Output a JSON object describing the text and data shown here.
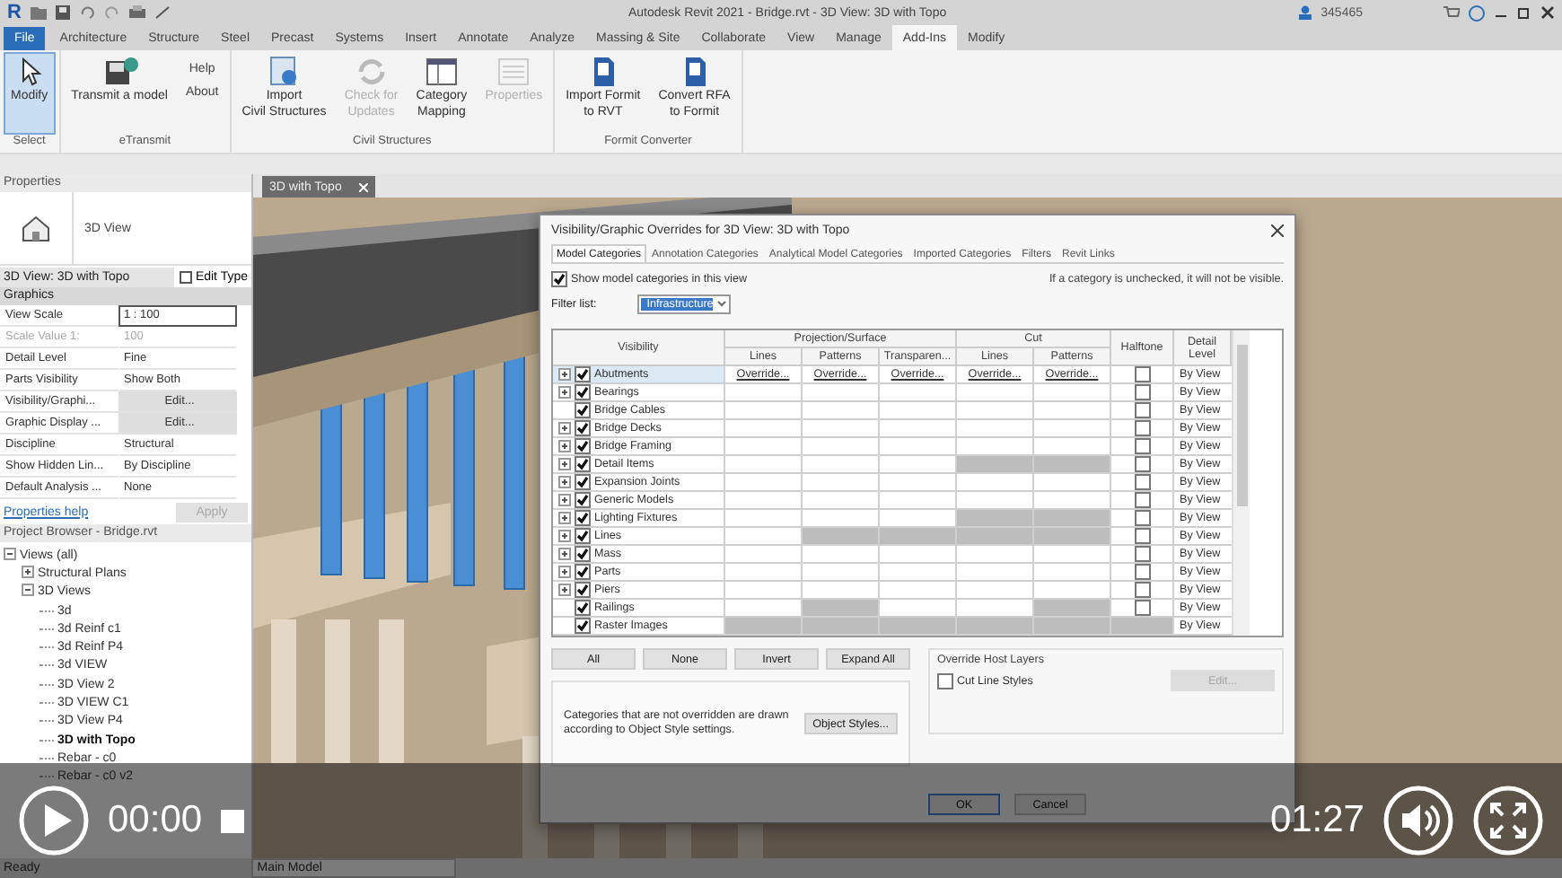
{
  "title_bar": {
    "logo": "R",
    "title": "Autodesk Revit 2021 - Bridge.rvt - 3D View: 3D with Topo",
    "user": "345465"
  },
  "ribbon_tabs": {
    "file": "File",
    "tabs": [
      {
        "label": "Architecture",
        "selected": false
      },
      {
        "label": "Structure",
        "selected": false
      },
      {
        "label": "Steel",
        "selected": false
      },
      {
        "label": "Precast",
        "selected": false
      },
      {
        "label": "Systems",
        "selected": false
      },
      {
        "label": "Insert",
        "selected": false
      },
      {
        "label": "Annotate",
        "selected": false
      },
      {
        "label": "Analyze",
        "selected": false
      },
      {
        "label": "Massing & Site",
        "selected": false
      },
      {
        "label": "Collaborate",
        "selected": false
      },
      {
        "label": "View",
        "selected": false
      },
      {
        "label": "Manage",
        "selected": false
      },
      {
        "label": "Add-Ins",
        "selected": true
      },
      {
        "label": "Modify",
        "selected": false
      }
    ]
  },
  "ribbon": {
    "panels": [
      {
        "label": "Select",
        "tools": [
          {
            "lines": [
              "Modify"
            ],
            "active": true,
            "disabled": false
          }
        ]
      },
      {
        "label": "eTransmit",
        "tools": [
          {
            "lines": [
              "Transmit a model"
            ],
            "active": false,
            "disabled": false
          }
        ],
        "links": [
          "Help",
          "About"
        ]
      },
      {
        "label": "Civil Structures",
        "tools": [
          {
            "lines": [
              "Import",
              "Civil Structures"
            ],
            "active": false,
            "disabled": false
          },
          {
            "lines": [
              "Check for",
              "Updates"
            ],
            "active": false,
            "disabled": true
          },
          {
            "lines": [
              "Category",
              "Mapping"
            ],
            "active": false,
            "disabled": false
          },
          {
            "lines": [
              "Properties"
            ],
            "active": false,
            "disabled": true
          }
        ]
      },
      {
        "label": "Formit Converter",
        "tools": [
          {
            "lines": [
              "Import Formit",
              "to RVT"
            ],
            "active": false,
            "disabled": false
          },
          {
            "lines": [
              "Convert RFA",
              "to Formit"
            ],
            "active": false,
            "disabled": false
          }
        ]
      }
    ]
  },
  "properties": {
    "title": "Properties",
    "type_name": "3D View",
    "instance": "3D View: 3D with Topo",
    "edit_type": "Edit Type",
    "section": "Graphics",
    "rows": [
      {
        "label": "View Scale",
        "value": "1 : 100",
        "kind": "input"
      },
      {
        "label": "Scale Value    1:",
        "value": "100",
        "kind": "readonly"
      },
      {
        "label": "Detail Level",
        "value": "Fine",
        "kind": "text"
      },
      {
        "label": "Parts Visibility",
        "value": "Show Both",
        "kind": "text"
      },
      {
        "label": "Visibility/Graphi...",
        "value": "Edit...",
        "kind": "button"
      },
      {
        "label": "Graphic Display ...",
        "value": "Edit...",
        "kind": "button"
      },
      {
        "label": "Discipline",
        "value": "Structural",
        "kind": "text"
      },
      {
        "label": "Show Hidden Lin...",
        "value": "By Discipline",
        "kind": "text"
      },
      {
        "label": "Default Analysis ...",
        "value": "None",
        "kind": "text"
      }
    ],
    "help": "Properties help",
    "apply": {
      "label": "Apply",
      "disabled": true
    }
  },
  "project_browser": {
    "title": "Project Browser - Bridge.rvt",
    "tree": [
      {
        "label": "Views (all)",
        "selected": false,
        "expanded": true,
        "children": [
          {
            "label": "Structural Plans",
            "selected": false,
            "expanded": false
          },
          {
            "label": "3D Views",
            "selected": false,
            "expanded": true,
            "children": [
              {
                "label": "3d",
                "selected": false
              },
              {
                "label": "3d Reinf c1",
                "selected": false
              },
              {
                "label": "3d Reinf P4",
                "selected": false
              },
              {
                "label": "3d VIEW",
                "selected": false
              },
              {
                "label": "3D View 2",
                "selected": false
              },
              {
                "label": "3D VIEW C1",
                "selected": false
              },
              {
                "label": "3D View P4",
                "selected": false
              },
              {
                "label": "3D with Topo",
                "selected": true
              },
              {
                "label": "Rebar -  c0",
                "selected": false
              },
              {
                "label": "Rebar -  c0 v2",
                "selected": false
              }
            ]
          }
        ]
      }
    ]
  },
  "view_tab": {
    "label": "3D with Topo"
  },
  "dialog": {
    "title": "Visibility/Graphic Overrides for 3D View: 3D with Topo",
    "tabs": [
      {
        "label": "Model Categories",
        "selected": true
      },
      {
        "label": "Annotation Categories",
        "selected": false
      },
      {
        "label": "Analytical Model Categories",
        "selected": false
      },
      {
        "label": "Imported Categories",
        "selected": false
      },
      {
        "label": "Filters",
        "selected": false
      },
      {
        "label": "Revit Links",
        "selected": false
      }
    ],
    "show_categories": {
      "label": "Show model categories in this view",
      "checked": true
    },
    "note": "If a category is unchecked, it will not be visible.",
    "filter": {
      "label": "Filter list:",
      "value": "Infrastructure"
    },
    "columns": {
      "visibility": "Visibility",
      "projection": "Projection/Surface",
      "projection_sub": [
        "Lines",
        "Patterns",
        "Transparen..."
      ],
      "cut": "Cut",
      "cut_sub": [
        "Lines",
        "Patterns"
      ],
      "halftone": "Halftone",
      "detail": "Detail Level"
    },
    "categories": [
      {
        "name": "Abutments",
        "expandable": true,
        "checked": true,
        "selected": true,
        "cells": [
          {
            "text": "Override...",
            "disabled": false
          },
          {
            "text": "Override...",
            "disabled": false
          },
          {
            "text": "Override...",
            "disabled": false
          },
          {
            "text": "Override...",
            "disabled": false
          },
          {
            "text": "Override...",
            "disabled": false
          }
        ],
        "halftone": {
          "checked": false,
          "disabled": false
        },
        "detail": "By View"
      },
      {
        "name": "Bearings",
        "expandable": true,
        "checked": true,
        "selected": false,
        "cells": [
          {
            "disabled": false
          },
          {
            "disabled": false
          },
          {
            "disabled": false
          },
          {
            "disabled": false
          },
          {
            "disabled": false
          }
        ],
        "halftone": {
          "checked": false,
          "disabled": false
        },
        "detail": "By View"
      },
      {
        "name": "Bridge Cables",
        "expandable": false,
        "checked": true,
        "selected": false,
        "cells": [
          {
            "disabled": false
          },
          {
            "disabled": false
          },
          {
            "disabled": false
          },
          {
            "disabled": false
          },
          {
            "disabled": false
          }
        ],
        "halftone": {
          "checked": false,
          "disabled": false
        },
        "detail": "By View"
      },
      {
        "name": "Bridge Decks",
        "expandable": true,
        "checked": true,
        "selected": false,
        "cells": [
          {
            "disabled": false
          },
          {
            "disabled": false
          },
          {
            "disabled": false
          },
          {
            "disabled": false
          },
          {
            "disabled": false
          }
        ],
        "halftone": {
          "checked": false,
          "disabled": false
        },
        "detail": "By View"
      },
      {
        "name": "Bridge Framing",
        "expandable": true,
        "checked": true,
        "selected": false,
        "cells": [
          {
            "disabled": false
          },
          {
            "disabled": false
          },
          {
            "disabled": false
          },
          {
            "disabled": false
          },
          {
            "disabled": false
          }
        ],
        "halftone": {
          "checked": false,
          "disabled": false
        },
        "detail": "By View"
      },
      {
        "name": "Detail Items",
        "expandable": true,
        "checked": true,
        "selected": false,
        "cells": [
          {
            "disabled": false
          },
          {
            "disabled": false
          },
          {
            "disabled": false
          },
          {
            "disabled": true
          },
          {
            "disabled": true
          }
        ],
        "halftone": {
          "checked": false,
          "disabled": false
        },
        "detail": "By View"
      },
      {
        "name": "Expansion Joints",
        "expandable": true,
        "checked": true,
        "selected": false,
        "cells": [
          {
            "disabled": false
          },
          {
            "disabled": false
          },
          {
            "disabled": false
          },
          {
            "disabled": false
          },
          {
            "disabled": false
          }
        ],
        "halftone": {
          "checked": false,
          "disabled": false
        },
        "detail": "By View"
      },
      {
        "name": "Generic Models",
        "expandable": true,
        "checked": true,
        "selected": false,
        "cells": [
          {
            "disabled": false
          },
          {
            "disabled": false
          },
          {
            "disabled": false
          },
          {
            "disabled": false
          },
          {
            "disabled": false
          }
        ],
        "halftone": {
          "checked": false,
          "disabled": false
        },
        "detail": "By View"
      },
      {
        "name": "Lighting Fixtures",
        "expandable": true,
        "checked": true,
        "selected": false,
        "cells": [
          {
            "disabled": false
          },
          {
            "disabled": false
          },
          {
            "disabled": false
          },
          {
            "disabled": true
          },
          {
            "disabled": true
          }
        ],
        "halftone": {
          "checked": false,
          "disabled": false
        },
        "detail": "By View"
      },
      {
        "name": "Lines",
        "expandable": true,
        "checked": true,
        "selected": false,
        "cells": [
          {
            "disabled": false
          },
          {
            "disabled": true
          },
          {
            "disabled": true
          },
          {
            "disabled": true
          },
          {
            "disabled": true
          }
        ],
        "halftone": {
          "checked": false,
          "disabled": false
        },
        "detail": "By View"
      },
      {
        "name": "Mass",
        "expandable": true,
        "checked": true,
        "selected": false,
        "cells": [
          {
            "disabled": false
          },
          {
            "disabled": false
          },
          {
            "disabled": false
          },
          {
            "disabled": false
          },
          {
            "disabled": false
          }
        ],
        "halftone": {
          "checked": false,
          "disabled": false
        },
        "detail": "By View"
      },
      {
        "name": "Parts",
        "expandable": true,
        "checked": true,
        "selected": false,
        "cells": [
          {
            "disabled": false
          },
          {
            "disabled": false
          },
          {
            "disabled": false
          },
          {
            "disabled": false
          },
          {
            "disabled": false
          }
        ],
        "halftone": {
          "checked": false,
          "disabled": false
        },
        "detail": "By View"
      },
      {
        "name": "Piers",
        "expandable": true,
        "checked": true,
        "selected": false,
        "cells": [
          {
            "disabled": false
          },
          {
            "disabled": false
          },
          {
            "disabled": false
          },
          {
            "disabled": false
          },
          {
            "disabled": false
          }
        ],
        "halftone": {
          "checked": false,
          "disabled": false
        },
        "detail": "By View"
      },
      {
        "name": "Railings",
        "expandable": false,
        "checked": true,
        "selected": false,
        "cells": [
          {
            "disabled": false
          },
          {
            "disabled": true
          },
          {
            "disabled": false
          },
          {
            "disabled": false
          },
          {
            "disabled": true
          }
        ],
        "halftone": {
          "checked": false,
          "disabled": false
        },
        "detail": "By View"
      },
      {
        "name": "Raster Images",
        "expandable": false,
        "checked": true,
        "selected": false,
        "cells": [
          {
            "disabled": true
          },
          {
            "disabled": true
          },
          {
            "disabled": true
          },
          {
            "disabled": true
          },
          {
            "disabled": true
          }
        ],
        "halftone": {
          "checked": false,
          "disabled": true
        },
        "detail": "By View"
      }
    ],
    "buttons": [
      "All",
      "None",
      "Invert",
      "Expand All"
    ],
    "host_layers": {
      "title": "Override Host Layers",
      "label": "Cut Line Styles",
      "checked": false,
      "edit": {
        "label": "Edit...",
        "disabled": true
      }
    },
    "info": "Categories that are not overridden are drawn according to Object Style settings.",
    "object_styles": "Object Styles...",
    "footer": [
      "OK",
      "Cancel"
    ]
  },
  "status_bar": {
    "text": "Ready",
    "model": "Main Model"
  },
  "video": {
    "playing": false,
    "elapsed": "00:00",
    "duration": "01:27"
  }
}
